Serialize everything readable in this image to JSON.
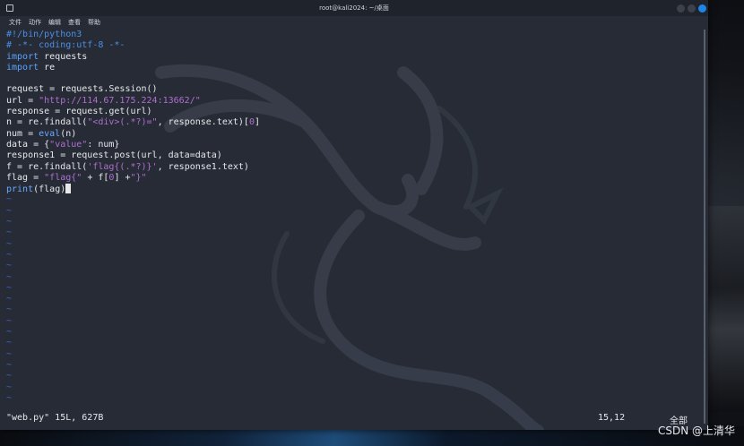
{
  "window": {
    "title": "root@kali2024: ~/桌面",
    "icons": {
      "terminal": "terminal-icon",
      "minimize": "minimize-icon",
      "maximize": "maximize-icon",
      "close": "close-icon"
    },
    "colors": {
      "close_button": "#1d86e8",
      "background": "#262b35"
    }
  },
  "menu": [
    "文件",
    "动作",
    "编辑",
    "查看",
    "帮助"
  ],
  "code": {
    "lines": [
      [
        {
          "t": "#!/bin/python3",
          "c": "comment"
        }
      ],
      [
        {
          "t": "# -*- coding:utf-8 -*-",
          "c": "comment"
        }
      ],
      [
        {
          "t": "import",
          "c": "kw"
        },
        {
          "t": " requests",
          "c": ""
        }
      ],
      [
        {
          "t": "import",
          "c": "kw"
        },
        {
          "t": " re",
          "c": ""
        }
      ],
      [
        {
          "t": "",
          "c": ""
        }
      ],
      [
        {
          "t": "request = requests.Session()",
          "c": ""
        }
      ],
      [
        {
          "t": "url = ",
          "c": ""
        },
        {
          "t": "\"http://114.67.175.224:13662/\"",
          "c": "str"
        }
      ],
      [
        {
          "t": "response = request.get(url)",
          "c": ""
        }
      ],
      [
        {
          "t": "n = re.findall(",
          "c": ""
        },
        {
          "t": "\"<div>(.*?)=\"",
          "c": "str"
        },
        {
          "t": ", response.text)[",
          "c": ""
        },
        {
          "t": "0",
          "c": "str"
        },
        {
          "t": "]",
          "c": ""
        }
      ],
      [
        {
          "t": "num = ",
          "c": ""
        },
        {
          "t": "eval",
          "c": "fn"
        },
        {
          "t": "(n)",
          "c": ""
        }
      ],
      [
        {
          "t": "data = {",
          "c": ""
        },
        {
          "t": "\"value\"",
          "c": "str"
        },
        {
          "t": ": num}",
          "c": ""
        }
      ],
      [
        {
          "t": "response1 = request.post(url, data=data)",
          "c": ""
        }
      ],
      [
        {
          "t": "f = re.findall(",
          "c": ""
        },
        {
          "t": "'flag{(.*?)}'",
          "c": "str"
        },
        {
          "t": ", response1.text)",
          "c": ""
        }
      ],
      [
        {
          "t": "flag = ",
          "c": ""
        },
        {
          "t": "\"flag{\"",
          "c": "str"
        },
        {
          "t": " + f[",
          "c": ""
        },
        {
          "t": "0",
          "c": "str"
        },
        {
          "t": "] +",
          "c": ""
        },
        {
          "t": "\"}\"",
          "c": "str"
        }
      ],
      [
        {
          "t": "print",
          "c": "fn"
        },
        {
          "t": "(flag)",
          "c": ""
        }
      ]
    ],
    "empty_marker": "~",
    "empty_lines": 19
  },
  "status": {
    "file": "\"web.py\" 15L, 627B",
    "position": "15,12",
    "scroll": "全部"
  },
  "watermark": "CSDN @上清华"
}
